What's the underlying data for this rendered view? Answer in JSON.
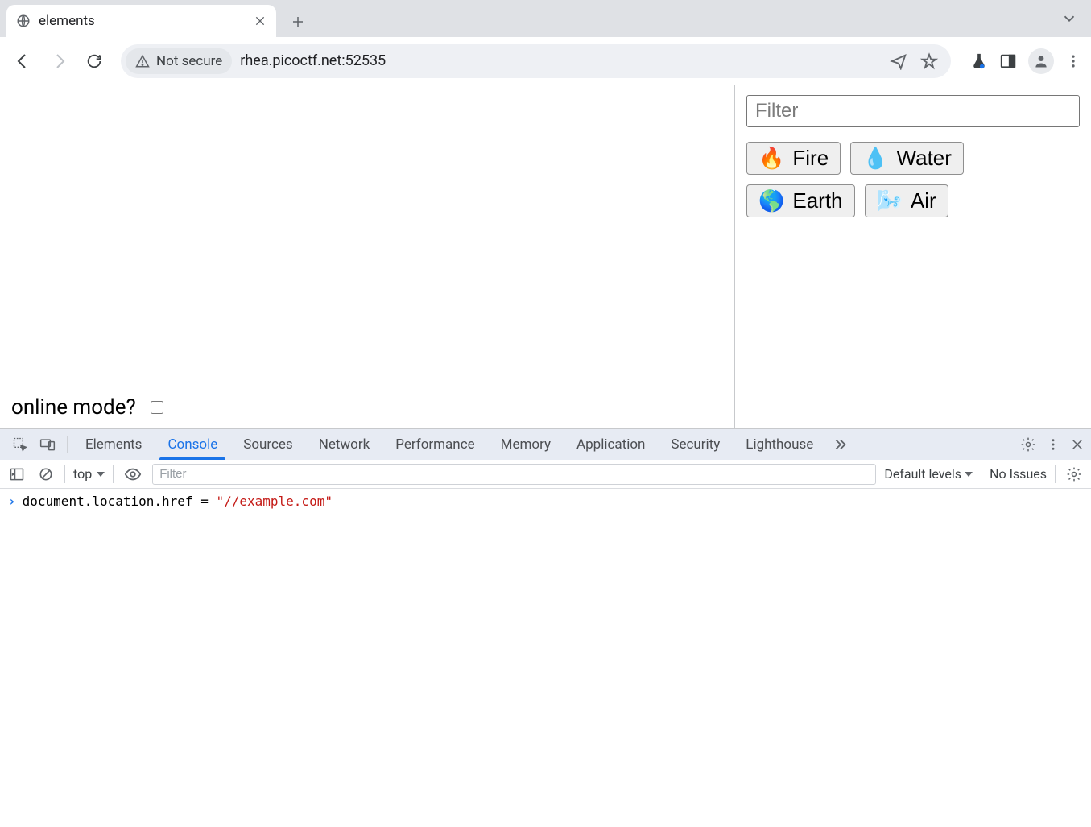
{
  "browser": {
    "tab_title": "elements",
    "security_label": "Not secure",
    "url": "rhea.picoctf.net:52535"
  },
  "page": {
    "filter_placeholder": "Filter",
    "online_label": "online mode?",
    "elements": [
      {
        "emoji": "🔥",
        "label": "Fire"
      },
      {
        "emoji": "💧",
        "label": "Water"
      },
      {
        "emoji": "🌎",
        "label": "Earth"
      },
      {
        "emoji": "🌬️",
        "label": "Air"
      }
    ]
  },
  "devtools": {
    "tabs": [
      "Elements",
      "Console",
      "Sources",
      "Network",
      "Performance",
      "Memory",
      "Application",
      "Security",
      "Lighthouse"
    ],
    "active_tab": "Console",
    "context": "top",
    "filter_placeholder": "Filter",
    "levels_label": "Default levels",
    "issues_label": "No Issues",
    "console_line": {
      "prefix": "document.location.href = ",
      "string": "\"//example.com\""
    }
  }
}
